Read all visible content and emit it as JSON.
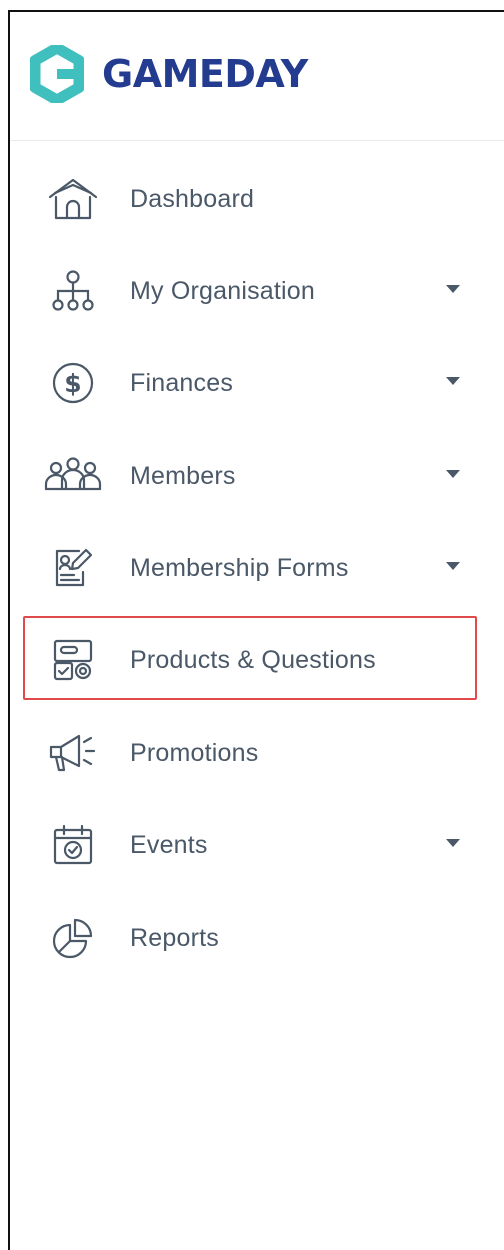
{
  "brand": {
    "name": "GAMEDAY",
    "logo_icon": "gameday-logo-icon",
    "text_color": "#243c8f",
    "icon_color": "#3fbfbd"
  },
  "colors": {
    "nav_text": "#4a5868",
    "icon_stroke": "#4a5868",
    "highlight_border": "#e04a4a",
    "divider": "#e6ebf0"
  },
  "nav": {
    "items": [
      {
        "id": "dashboard",
        "label": "Dashboard",
        "icon": "house-icon",
        "has_dropdown": false
      },
      {
        "id": "my-organisation",
        "label": "My Organisation",
        "icon": "org-chart-icon",
        "has_dropdown": true
      },
      {
        "id": "finances",
        "label": "Finances",
        "icon": "dollar-circle-icon",
        "has_dropdown": true
      },
      {
        "id": "members",
        "label": "Members",
        "icon": "people-group-icon",
        "has_dropdown": true
      },
      {
        "id": "membership-forms",
        "label": "Membership Forms",
        "icon": "form-edit-icon",
        "has_dropdown": true
      },
      {
        "id": "products-questions",
        "label": "Products & Questions",
        "icon": "product-card-icon",
        "has_dropdown": false,
        "highlighted": true
      },
      {
        "id": "promotions",
        "label": "Promotions",
        "icon": "megaphone-icon",
        "has_dropdown": false
      },
      {
        "id": "events",
        "label": "Events",
        "icon": "calendar-check-icon",
        "has_dropdown": true
      },
      {
        "id": "reports",
        "label": "Reports",
        "icon": "pie-chart-icon",
        "has_dropdown": false
      }
    ]
  }
}
